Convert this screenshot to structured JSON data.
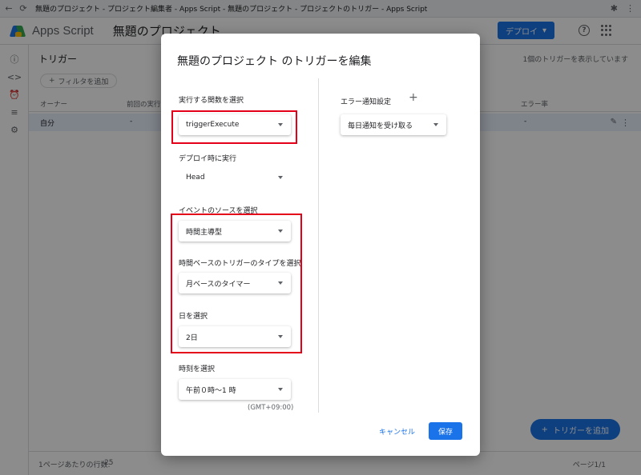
{
  "browser": {
    "title": "無題のプロジェクト - プロジェクト編集者 - Apps Script - 無題のプロジェクト - プロジェクトのトリガー - Apps Script"
  },
  "header": {
    "app_name": "Apps Script",
    "project_name": "無題のプロジェクト",
    "deploy_label": "デプロイ"
  },
  "page": {
    "title": "トリガー",
    "trigger_count": "1個のトリガーを表示しています",
    "filter_label": "フィルタを追加",
    "columns": [
      "オーナー",
      "前回の実行",
      "エラー率"
    ],
    "row": {
      "owner": "自分",
      "last_run": "-",
      "error_rate": "-"
    },
    "pager_rows_label": "1ページあたりの行数:",
    "pager_rows_value": "25",
    "pager_page": "ページ1/1",
    "add_trigger_label": "トリガーを追加"
  },
  "modal": {
    "title": "無題のプロジェクト のトリガーを編集",
    "function_label": "実行する関数を選択",
    "function_value": "triggerExecute",
    "deploy_label": "デプロイ時に実行",
    "deploy_value": "Head",
    "source_label": "イベントのソースを選択",
    "source_value": "時間主導型",
    "type_label": "時間ベースのトリガーのタイプを選択",
    "type_value": "月ベースのタイマー",
    "day_label": "日を選択",
    "day_value": "2日",
    "time_label": "時刻を選択",
    "time_value": "午前０時～1 時",
    "timezone": "(GMT+09:00)",
    "error_label": "エラー通知設定",
    "error_value": "毎日通知を受け取る",
    "cancel_label": "キャンセル",
    "save_label": "保存"
  },
  "colors": {
    "accent": "#1a73e8",
    "highlight": "#e5001a"
  }
}
